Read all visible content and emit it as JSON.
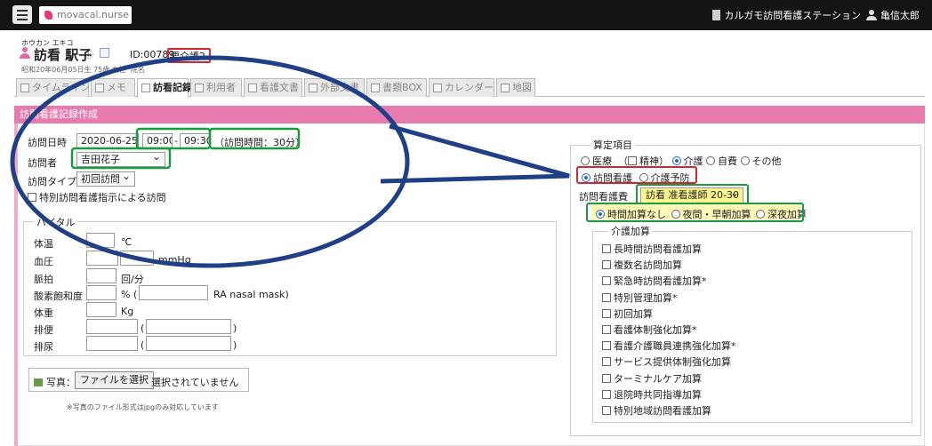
{
  "header": {
    "brand": "movacal.nurse",
    "station": "カルガモ訪問看護ステーション",
    "user": "亀信太郎"
  },
  "patient": {
    "kana": "ホウカン エキコ",
    "name": "訪看 駅子",
    "links_mark": "ⓚ",
    "id": "ID:00789",
    "care_level": "要介護2",
    "sub_info": "昭和20年06月05日生 75歳 女性",
    "hospital": "院名"
  },
  "tabs": [
    {
      "label": "タイムライン"
    },
    {
      "label": "メモ"
    },
    {
      "label": "訪看記録"
    },
    {
      "label": "利用者"
    },
    {
      "label": "看護文書"
    },
    {
      "label": "外部文書"
    },
    {
      "label": "書類BOX"
    },
    {
      "label": "カレンダー"
    },
    {
      "label": "地図"
    }
  ],
  "panel_title": "訪問看護記録作成",
  "form": {
    "visit_date_label": "訪問日時",
    "visit_date": "2020-06-25",
    "time_start": "09:00",
    "time_sep": "-",
    "time_end": "09:30",
    "duration": "（訪問時間：30分）",
    "visitor_label": "訪問者",
    "visitor": "吉田花子",
    "visit_type_label": "訪問タイプ",
    "visit_type": "初回訪問",
    "special_instruction": "特別訪問看護指示による訪問"
  },
  "vitals": {
    "legend": "バイタル",
    "temp_label": "体温",
    "temp_unit": "℃",
    "bp_label": "血圧",
    "bp_unit": "mmHg",
    "pulse_label": "脈拍",
    "pulse_unit": "回/分",
    "spo2_label": "酸素飽和度",
    "spo2_unit": "% (",
    "spo2_suffix": "RA nasal mask)",
    "weight_label": "体重",
    "weight_unit": "Kg",
    "stool_label": "排便",
    "urine_label": "排尿",
    "paren_open": "(",
    "paren_close": ")"
  },
  "photo": {
    "label": "写真：",
    "button": "ファイルを選択",
    "status": "選択されていません",
    "note": "※写真のファイル形式はjpgのみ対応しています"
  },
  "calc": {
    "legend": "算定項目",
    "payer_iryo": "医療",
    "payer_seishin": "（",
    "payer_seishin_label": "精神）",
    "payer_kaigo": "介護",
    "payer_jihi": "自費",
    "payer_other": "その他",
    "kind_houmon": "訪問看護",
    "kind_yobo": "介護予防",
    "fee_label": "訪問看護費",
    "fee_value": "訪看 准看護師 20-30",
    "time_add_none": "時間加算なし",
    "time_add_night": "夜間・早朝加算",
    "time_add_late": "深夜加算",
    "kaigo_legend": "介護加算",
    "kaigo_items": [
      "長時間訪問看護加算",
      "複数名訪問加算",
      "緊急時訪問看護加算*",
      "特別管理加算*",
      "初回加算",
      "看護体制強化加算*",
      "看護介護職員連携強化加算*",
      "サービス提供体制強化加算",
      "ターミナルケア加算",
      "退院時共同指導加算",
      "特別地域訪問看護加算"
    ]
  },
  "colors": {
    "accent_pink": "#e87bad",
    "highlight_red": "#d0282e",
    "highlight_green": "#1c9a3f",
    "callout_blue": "#1f3f86"
  }
}
